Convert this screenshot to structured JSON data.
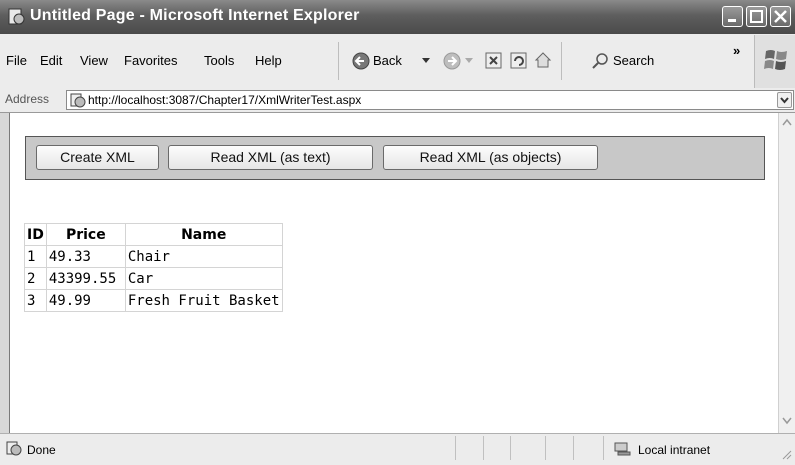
{
  "window": {
    "title": "Untitled Page - Microsoft Internet Explorer"
  },
  "menu": {
    "items": [
      "File",
      "Edit",
      "View",
      "Favorites",
      "Tools",
      "Help"
    ]
  },
  "toolbar": {
    "back_label": "Back",
    "search_label": "Search",
    "overflow": "»"
  },
  "address": {
    "label": "Address",
    "url": "http://localhost:3087/Chapter17/XmlWriterTest.aspx"
  },
  "buttons": {
    "create_xml": "Create XML",
    "read_xml_text": "Read XML (as text)",
    "read_xml_objects": "Read XML (as objects)"
  },
  "grid": {
    "headers": [
      "ID",
      "Price",
      "Name"
    ],
    "rows": [
      [
        "1",
        "49.33",
        "Chair"
      ],
      [
        "2",
        "43399.55",
        "Car"
      ],
      [
        "3",
        "49.99",
        "Fresh Fruit Basket"
      ]
    ]
  },
  "status": {
    "text": "Done",
    "zone": "Local intranet"
  }
}
